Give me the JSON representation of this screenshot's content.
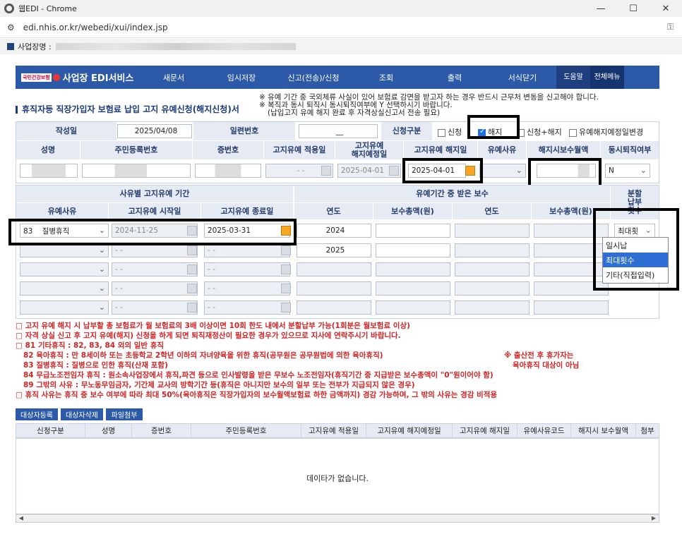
{
  "window": {
    "title": "웹EDI - Chrome",
    "url": "edi.nhis.or.kr/webedi/xui/index.jsp",
    "biz_label": "사업장명 :"
  },
  "nav": {
    "logo_small": "국민건강보험",
    "logo_title": "사업장 EDI서비스",
    "items": [
      "새문서",
      "임시저장",
      "신고(전송)/신청",
      "조회",
      "출력",
      "서식닫기"
    ],
    "help": "도움말",
    "all_menu": "전체메뉴 열기"
  },
  "page": {
    "title": "휴직자등 직장가입자 보험료 납입 고지 유예신청(해지신청)서",
    "notice": [
      "※ 유예 기간 중 국외체류 사실이 있어 보험료 감면을 받고자 하는 경우 반드시 근무처 변동을 신고해야 합니다.",
      "※ 복직과 동시 퇴직시 동시퇴직여부에 Y 선택하시기 바랍니다.",
      "(납입고지 유예 해지 완료 후 자격상실신고서 전송 필요)"
    ]
  },
  "form": {
    "write_date_label": "작성일",
    "write_date": "2025/04/08",
    "serial_label": "일련번호",
    "serial": "__",
    "apply_type_label": "신청구분",
    "apply_options": [
      "신청",
      "해지",
      "신청+해지",
      "유예해지예정일변경"
    ],
    "headers": [
      "성명",
      "주민등록번호",
      "증번호",
      "고지유예 적용일",
      "고지유예\n해지예정일",
      "고지유예 해지일",
      "유예사유",
      "해지시보수월액",
      "동시퇴직여부"
    ],
    "apply_date": "- -",
    "planned_end": "2025-04-01",
    "end_date": "2025-04-01",
    "retire": "N"
  },
  "period": {
    "section_label": "사유별 고지유예 기간",
    "pay_section_label": "유예기간 중 받은 보수",
    "split_label": "분할\n납부\n횟수",
    "cols": [
      "유예사유",
      "고지유예 시작일",
      "고지유예 종료일",
      "연도",
      "보수총액(원)",
      "연도",
      "보수총액(원)"
    ],
    "row1": {
      "reason": "83    질병휴직",
      "start": "2024-11-25",
      "end": "2025-03-31",
      "year1": "2024",
      "split": "최대횟"
    },
    "row2": {
      "year1": "2025"
    },
    "empty_date": "- -"
  },
  "dropdown": {
    "options": [
      "일시납",
      "최대횟수",
      "기타(직접입력)"
    ]
  },
  "notes": [
    "□ 고지 유예 해지 시 납부할 총 보험료가 월 보험료의 3배 이상이면 10회 한도 내에서 분할납부 가능(1회분은 월보험료 이상)",
    "□ 자격 상실 신고 후 고지 유예(해지) 신청을 하게 되면 퇴직재정산이 필요한 경우가 있으므로 지사에 연락주시기 바랍니다.",
    "□ 81 기타휴직 : 82, 83, 84 외의 일반 휴직",
    "   82 육아휴직 : 만 8세이하 또는 초등학교 2학년 이하의 자녀양육을 위한 휴직(공무원은 공무원법에 의한 육아휴직)",
    "※ 출산전 후 휴가자는",
    "육아휴직 대상이 아님",
    "   83 질병휴직 : 질병으로 인한 휴직(산재 포함)",
    "   84 무급노조전임자 휴직 : 원소속사업장에서 휴직,파견 등으로 인사발령을 받은 무보수 노조전임자(휴직기간 중 지급받은 보수총액이 \"0\"원이어야 함)",
    "   89 그밖의 사유 : 무노동무임금자, 기간제 교사의 방학기간 등(휴직은 아니지만 보수의 일부 또는 전부가 지급되지 않은 경우)",
    "□ 휴직 사유는 휴직 중 보수 여부에 따라 최대 50%(육아휴직은 직장가입자의 보수월액보험료 하한 금액까지) 경감 가능하며, 그 밖의 사유는 경감 비적용"
  ],
  "buttons": [
    "대상자등록",
    "대상자삭제",
    "파일첨부"
  ],
  "table": {
    "headers": [
      "신청구분",
      "성명",
      "증번호",
      "주민등록번호",
      "고지유예 적용일",
      "고지유예 해지예정일",
      "고지유예 해지일",
      "유예사유코드",
      "해지시 보수월액",
      "첨부"
    ],
    "empty": "데이타가 없습니다."
  }
}
